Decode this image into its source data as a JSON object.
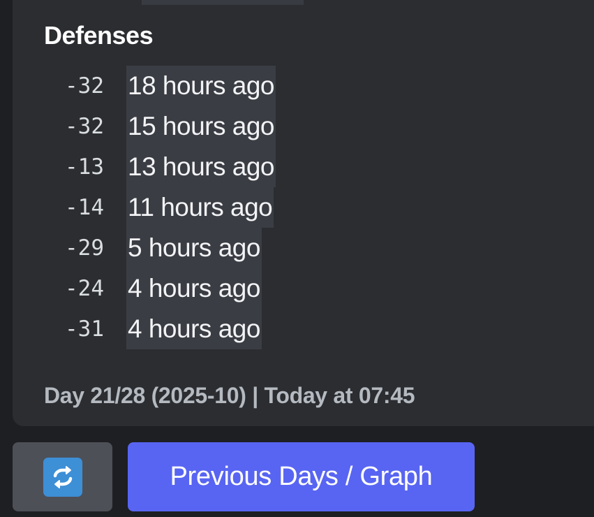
{
  "embed": {
    "section_title": "Defenses",
    "rows": [
      {
        "score": "-32",
        "time": "18 hours ago"
      },
      {
        "score": "-32",
        "time": "15 hours ago"
      },
      {
        "score": "-13",
        "time": "13 hours ago"
      },
      {
        "score": "-14",
        "time": "11 hours ago"
      },
      {
        "score": "-29",
        "time": "5 hours ago"
      },
      {
        "score": "-24",
        "time": "4 hours ago"
      },
      {
        "score": "-31",
        "time": "4 hours ago"
      }
    ],
    "footer": "Day 21/28 (2025-10) | Today at 07:45"
  },
  "buttons": {
    "refresh_icon": "refresh-icon",
    "primary_label": "Previous Days / Graph"
  },
  "colors": {
    "background": "#1e1f22",
    "embed": "#2b2d31",
    "primary": "#5865f2",
    "secondary": "#4e5058",
    "refresh_icon": "#3d8fd6"
  }
}
